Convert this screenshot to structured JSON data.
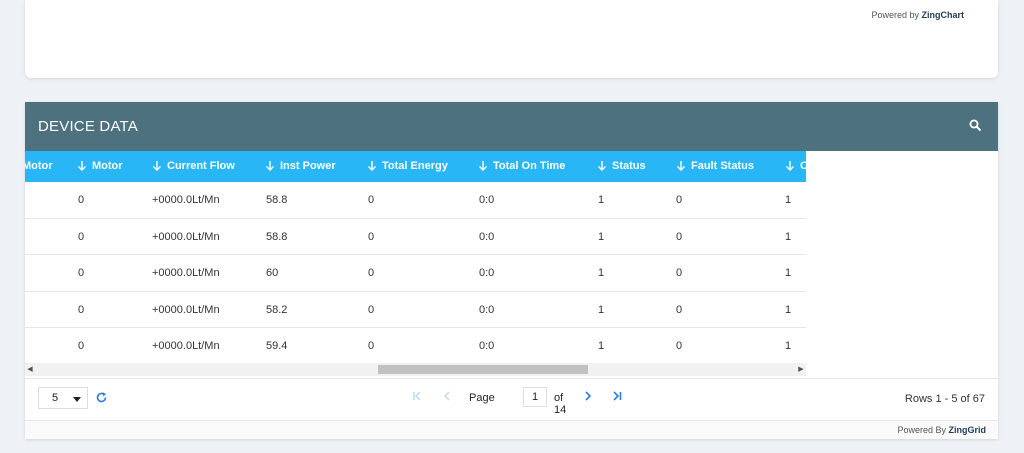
{
  "chart_footer": {
    "prefix": "Powered by",
    "brand": "ZingChart"
  },
  "grid": {
    "title": "DEVICE DATA",
    "columns": [
      "Motor",
      "Motor",
      "Current Flow",
      "Inst Power",
      "Total Energy",
      "Total On Time",
      "Status",
      "Fault Status",
      "C"
    ],
    "rows": [
      [
        "",
        "0",
        "+0000.0Lt/Mn",
        "58.8",
        "0",
        "0:0",
        "1",
        "0",
        "1"
      ],
      [
        "",
        "0",
        "+0000.0Lt/Mn",
        "58.8",
        "0",
        "0:0",
        "1",
        "0",
        "1"
      ],
      [
        "",
        "0",
        "+0000.0Lt/Mn",
        "60",
        "0",
        "0:0",
        "1",
        "0",
        "1"
      ],
      [
        "",
        "0",
        "+0000.0Lt/Mn",
        "58.2",
        "0",
        "0:0",
        "1",
        "0",
        "1"
      ],
      [
        "",
        "0",
        "+0000.0Lt/Mn",
        "59.4",
        "0",
        "0:0",
        "1",
        "0",
        "1"
      ]
    ],
    "pagination": {
      "page_size": "5",
      "page_label": "Page",
      "current_page": "1",
      "of_label": "of 14",
      "rows_info": "Rows 1 - 5 of 67"
    },
    "footer": {
      "prefix": "Powered By",
      "brand": "ZingGrid"
    }
  },
  "colors": {
    "header_bg": "#4e7180",
    "columns_bg": "#29b6f6",
    "accent": "#29b6f6"
  },
  "icons": [
    "search-icon",
    "arrow-down-icon",
    "chevron-down-icon",
    "refresh-icon",
    "first-page-icon",
    "prev-page-icon",
    "next-page-icon",
    "last-page-icon"
  ]
}
